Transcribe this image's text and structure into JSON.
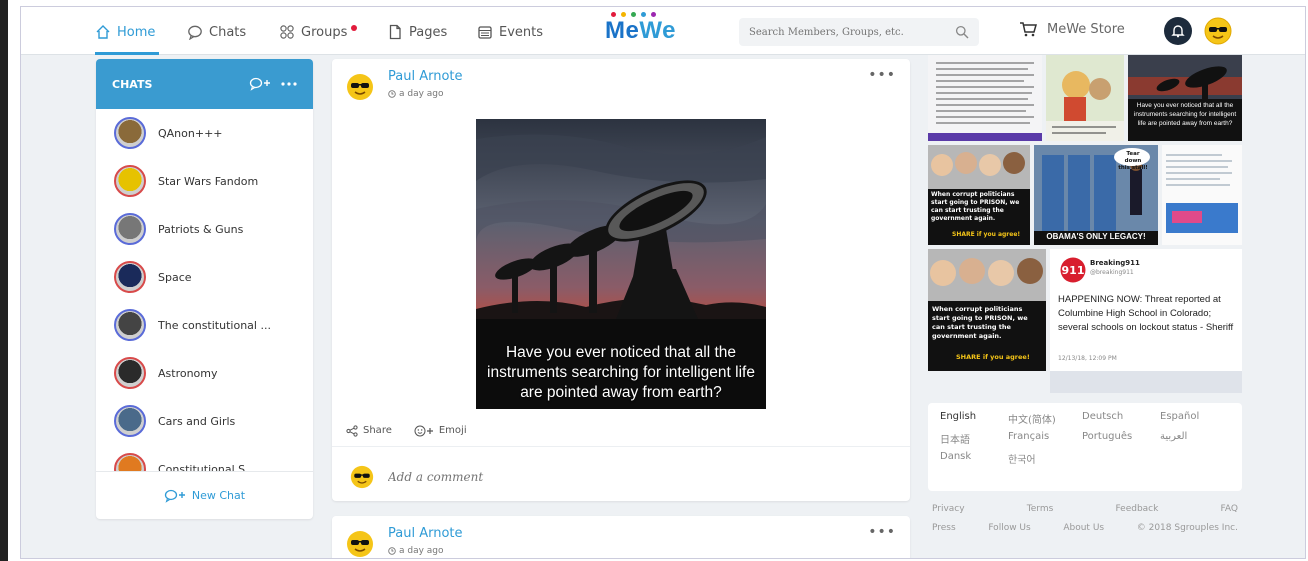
{
  "nav": {
    "items": [
      {
        "label": "Home",
        "icon": "home-icon",
        "active": true
      },
      {
        "label": "Chats",
        "icon": "chat-bubble-icon"
      },
      {
        "label": "Groups",
        "icon": "groups-icon",
        "notification": true
      },
      {
        "label": "Pages",
        "icon": "page-icon"
      },
      {
        "label": "Events",
        "icon": "calendar-icon"
      }
    ],
    "logo": {
      "part1": "Me",
      "part2": "We"
    },
    "search_placeholder": "Search Members, Groups, etc.",
    "store_label": "MeWe Store"
  },
  "chats": {
    "header": "CHATS",
    "items": [
      {
        "name": "QAnon+++",
        "color": "#8a6a3a"
      },
      {
        "name": "Star Wars Fandom",
        "color": "#e6c200"
      },
      {
        "name": "Patriots & Guns",
        "color": "#777777"
      },
      {
        "name": "Space",
        "color": "#1a2a5a"
      },
      {
        "name": "The constitutional ...",
        "color": "#444444"
      },
      {
        "name": "Astronomy",
        "color": "#2a2a2a"
      },
      {
        "name": "Cars and Girls",
        "color": "#4a6a8a"
      },
      {
        "name": "Constitutional S...",
        "color": "#e07a20"
      }
    ],
    "new_chat_label": "New Chat"
  },
  "posts": [
    {
      "author": "Paul Arnote",
      "time": "a day ago",
      "image_caption": "Have you ever noticed that all the instruments searching for intelligent life are pointed away from earth?",
      "share_label": "Share",
      "emoji_label": "Emoji",
      "comment_placeholder": "Add a comment"
    },
    {
      "author": "Paul Arnote",
      "time": "a day ago"
    }
  ],
  "tiles": {
    "meme_text": "Have you ever noticed that all the instruments searching for intelligent life are pointed away from earth?",
    "prison_text": "When corrupt politicians start going to PRISON, we can start trusting the government again.",
    "share_text": "SHARE if you agree!",
    "obama_text": "OBAMA'S ONLY LEGACY!",
    "tear_text": "Tear down this stall!",
    "tweet_name": "Breaking911",
    "tweet_handle": "@breaking911",
    "tweet_text": "HAPPENING NOW: Threat reported at Columbine High School in Colorado; several schools on lockout status - Sheriff",
    "tweet_time": "12/13/18, 12:09 PM"
  },
  "languages": [
    {
      "label": "English",
      "selected": true
    },
    {
      "label": "中文(简体)"
    },
    {
      "label": "Deutsch"
    },
    {
      "label": "Español"
    },
    {
      "label": "日本語"
    },
    {
      "label": "Français"
    },
    {
      "label": "Português"
    },
    {
      "label": "العربية"
    },
    {
      "label": "Dansk"
    },
    {
      "label": "한국어"
    }
  ],
  "footer": {
    "row1": [
      "Privacy",
      "Terms",
      "Feedback",
      "FAQ"
    ],
    "row2": [
      "Press",
      "Follow Us",
      "About Us",
      "© 2018 Sgrouples Inc."
    ]
  },
  "colors": {
    "accent": "#2f9bd6",
    "chat_header": "#3a9bd0",
    "notification": "#e21b3c",
    "background": "#eef1f4"
  }
}
